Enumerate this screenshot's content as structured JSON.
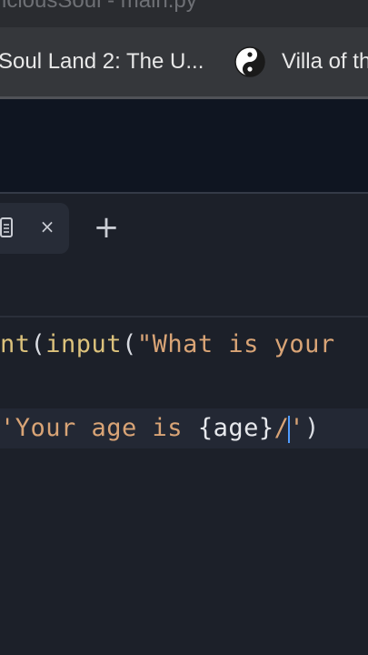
{
  "window": {
    "title": "iciousSoul - main.py"
  },
  "bookmarks": [
    {
      "label": "Soul Land 2: The U...",
      "icon": "none"
    },
    {
      "label": "Villa of th",
      "icon": "yin-yang-icon"
    }
  ],
  "tabs": {
    "close_label": "×",
    "new_tab_label": "+"
  },
  "editor": {
    "line1": {
      "fn1": "nt",
      "p1": "(",
      "fn2": "input",
      "p2": "(",
      "str": "\"What is your"
    },
    "line2": {
      "str_start": "'Your age is ",
      "brace_open": "{",
      "var": "age",
      "brace_close": "}",
      "str_end1": "/",
      "str_end2": "'",
      "p_close": ")"
    }
  }
}
